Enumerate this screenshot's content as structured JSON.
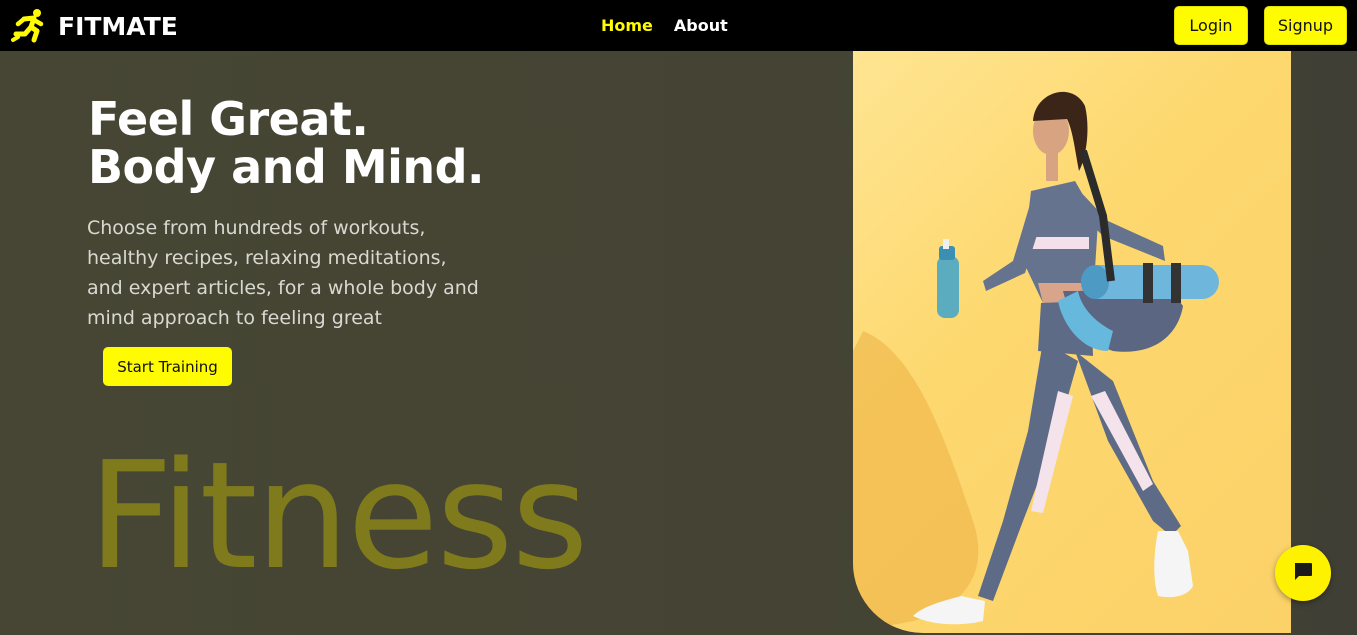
{
  "brand": {
    "name": "FITMATE",
    "logo_icon": "running-person-icon",
    "accent": "#fffb00"
  },
  "nav": {
    "links": [
      {
        "label": "Home",
        "active": true
      },
      {
        "label": "About",
        "active": false
      }
    ],
    "login_label": "Login",
    "signup_label": "Signup"
  },
  "hero": {
    "headline_line1": "Feel Great.",
    "headline_line2": "Body and Mind.",
    "description": "Choose from hundreds of workouts, healthy recipes, relaxing meditations, and expert articles, for a whole body and mind approach to feeling great",
    "cta_label": "Start Training",
    "background_word": "Fitness",
    "image": "woman-walking-with-yoga-mat-and-water-bottle"
  },
  "chat": {
    "icon": "chat-bubble-icon"
  }
}
